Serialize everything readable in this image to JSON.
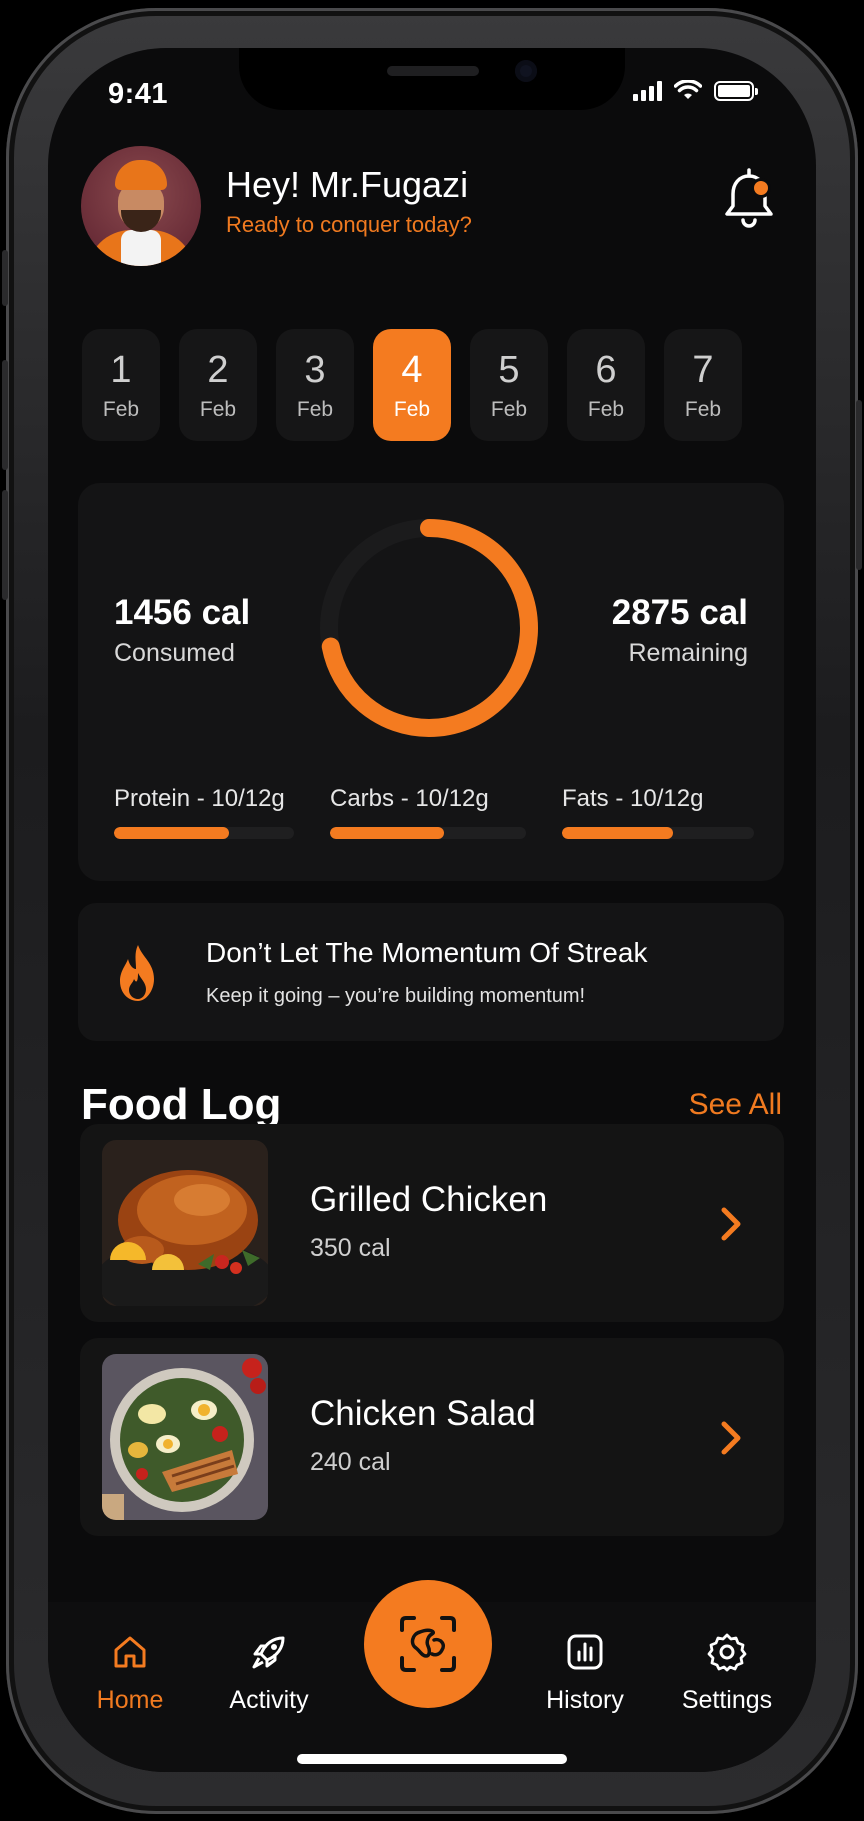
{
  "status_bar": {
    "time": "9:41"
  },
  "header": {
    "greeting": "Hey! Mr.Fugazi",
    "subtitle": "Ready to conquer today?"
  },
  "dates": [
    {
      "day": "1",
      "month": "Feb",
      "active": false
    },
    {
      "day": "2",
      "month": "Feb",
      "active": false
    },
    {
      "day": "3",
      "month": "Feb",
      "active": false
    },
    {
      "day": "4",
      "month": "Feb",
      "active": true
    },
    {
      "day": "5",
      "month": "Feb",
      "active": false
    },
    {
      "day": "6",
      "month": "Feb",
      "active": false
    },
    {
      "day": "7",
      "month": "Feb",
      "active": false
    }
  ],
  "calories": {
    "consumed_value": "1456 cal",
    "consumed_label": "Consumed",
    "remaining_value": "2875 cal",
    "remaining_label": "Remaining",
    "ring_progress": 0.72
  },
  "macros": [
    {
      "label": "Protein - 10/12g",
      "progress": 0.64
    },
    {
      "label": "Carbs - 10/12g",
      "progress": 0.58
    },
    {
      "label": "Fats - 10/12g",
      "progress": 0.58
    }
  ],
  "streak": {
    "title": "Don’t Let The Momentum Of Streak",
    "subtitle": "Keep it going – you’re building momentum!"
  },
  "food_log": {
    "title": "Food Log",
    "see_all": "See All",
    "items": [
      {
        "name": "Grilled Chicken",
        "calories": "350 cal"
      },
      {
        "name": "Chicken Salad",
        "calories": "240 cal"
      }
    ]
  },
  "tabbar": {
    "home": "Home",
    "activity": "Activity",
    "history": "History",
    "settings": "Settings"
  },
  "colors": {
    "accent": "#F47B20",
    "background": "#0B0B0C",
    "card": "#141415"
  }
}
